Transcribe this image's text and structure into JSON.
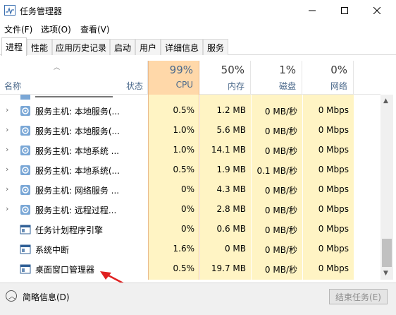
{
  "window": {
    "title": "任务管理器"
  },
  "menubar": {
    "items": [
      "文件(F)",
      "选项(O)",
      "查看(V)"
    ]
  },
  "tabs": [
    "进程",
    "性能",
    "应用历史记录",
    "启动",
    "用户",
    "详细信息",
    "服务"
  ],
  "columns": {
    "name": "名称",
    "status": "状态",
    "cpu": {
      "percent": "99%",
      "label": "CPU"
    },
    "memory": {
      "percent": "50%",
      "label": "内存"
    },
    "disk": {
      "percent": "1%",
      "label": "磁盘"
    },
    "network": {
      "percent": "0%",
      "label": "网络"
    }
  },
  "rows": [
    {
      "name": "服务主机: 本地服务(...",
      "cpu": "0.5%",
      "memory": "1.2 MB",
      "disk": "0 MB/秒",
      "network": "0 Mbps",
      "expandable": true,
      "icon": "gear-icon"
    },
    {
      "name": "服务主机: 本地服务(...",
      "cpu": "1.0%",
      "memory": "5.6 MB",
      "disk": "0 MB/秒",
      "network": "0 Mbps",
      "expandable": true,
      "icon": "gear-icon"
    },
    {
      "name": "服务主机: 本地系统 ...",
      "cpu": "1.0%",
      "memory": "14.1 MB",
      "disk": "0 MB/秒",
      "network": "0 Mbps",
      "expandable": true,
      "icon": "gear-icon"
    },
    {
      "name": "服务主机: 本地系统(...",
      "cpu": "0.5%",
      "memory": "1.9 MB",
      "disk": "0.1 MB/秒",
      "network": "0 Mbps",
      "expandable": true,
      "icon": "gear-icon"
    },
    {
      "name": "服务主机: 网络服务 ...",
      "cpu": "0%",
      "memory": "4.3 MB",
      "disk": "0 MB/秒",
      "network": "0 Mbps",
      "expandable": true,
      "icon": "gear-icon"
    },
    {
      "name": "服务主机: 远程过程...",
      "cpu": "0%",
      "memory": "2.8 MB",
      "disk": "0 MB/秒",
      "network": "0 Mbps",
      "expandable": true,
      "icon": "gear-icon"
    },
    {
      "name": "任务计划程序引擎",
      "cpu": "0%",
      "memory": "0.6 MB",
      "disk": "0 MB/秒",
      "network": "0 Mbps",
      "expandable": false,
      "icon": "window-icon"
    },
    {
      "name": "系统中断",
      "cpu": "1.6%",
      "memory": "0 MB",
      "disk": "0 MB/秒",
      "network": "0 Mbps",
      "expandable": false,
      "icon": "window-icon"
    },
    {
      "name": "桌面窗口管理器",
      "cpu": "0.5%",
      "memory": "19.7 MB",
      "disk": "0 MB/秒",
      "network": "0 Mbps",
      "expandable": false,
      "icon": "window-icon"
    }
  ],
  "footer": {
    "fewer_details": "简略信息(D)",
    "end_task": "结束任务(E)"
  },
  "colors": {
    "cpu_header": "#ffd8a9",
    "cell_highlight": "#fff4c4",
    "arrow_annotation": "#e02020"
  }
}
